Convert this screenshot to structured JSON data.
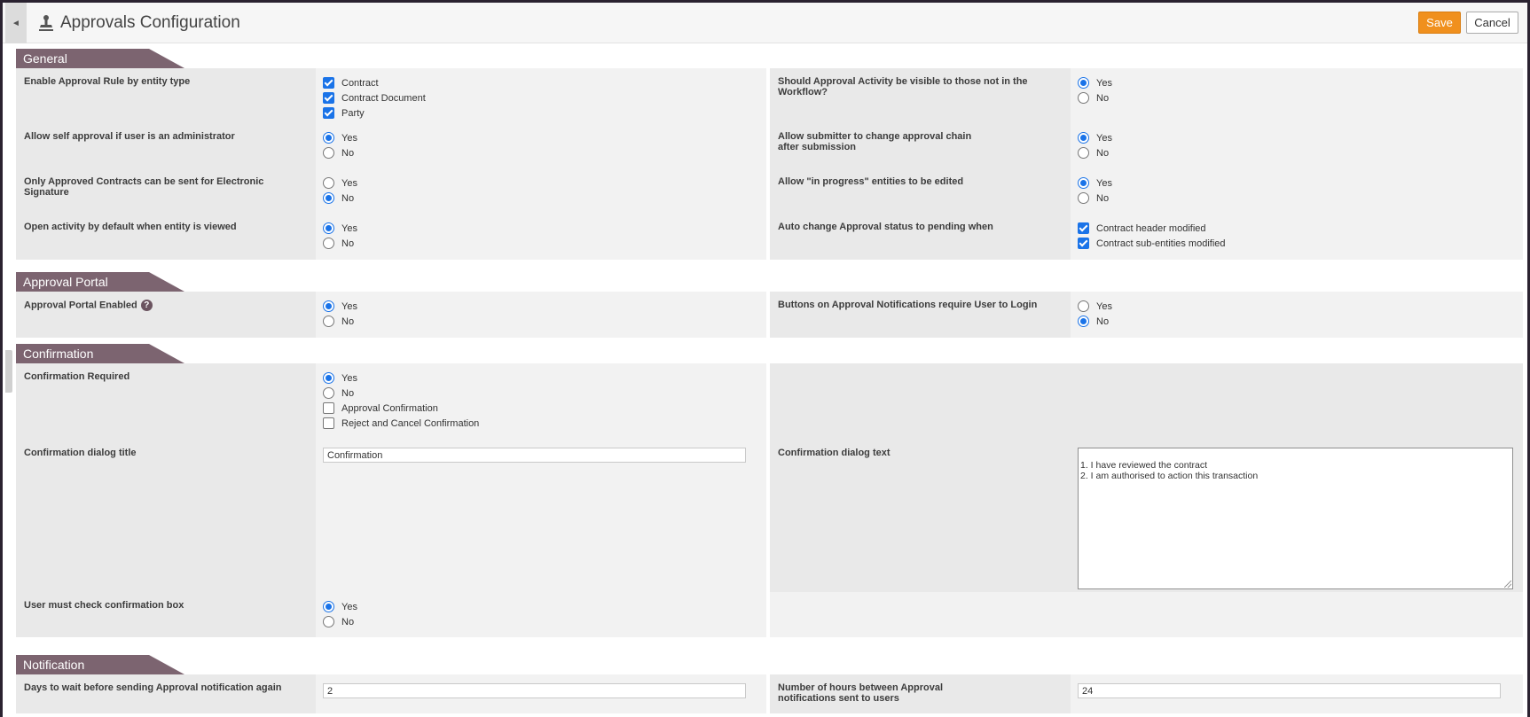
{
  "header": {
    "title": "Approvals Configuration",
    "save_label": "Save",
    "cancel_label": "Cancel",
    "back_glyph": "◄"
  },
  "icons": {
    "back": "triangle-left-icon",
    "title": "stamp-icon",
    "help": "question-circle-icon"
  },
  "colors": {
    "accent": "#f0901e",
    "section_header": "#7c6470",
    "control_blue": "#1a73e8"
  },
  "general": {
    "title": "General",
    "entity_type": {
      "label": "Enable Approval Rule by entity type",
      "options": [
        {
          "label": "Contract",
          "checked": true
        },
        {
          "label": "Contract Document",
          "checked": true
        },
        {
          "label": "Party",
          "checked": true
        }
      ]
    },
    "visible_activity": {
      "label": "Should Approval Activity be visible to those not in the Workflow?",
      "yes": "Yes",
      "no": "No",
      "selected": "Yes"
    },
    "self_approval": {
      "label": "Allow self approval if user is an administrator",
      "yes": "Yes",
      "no": "No",
      "selected": "Yes"
    },
    "change_chain": {
      "label": "Allow submitter to change approval chain after submission",
      "yes": "Yes",
      "no": "No",
      "selected": "Yes"
    },
    "esign": {
      "label": "Only Approved Contracts can be sent for Electronic Signature",
      "yes": "Yes",
      "no": "No",
      "selected": "No"
    },
    "in_progress": {
      "label": "Allow \"in progress\" entities to be edited",
      "yes": "Yes",
      "no": "No",
      "selected": "Yes"
    },
    "open_activity": {
      "label": "Open activity by default when entity is viewed",
      "yes": "Yes",
      "no": "No",
      "selected": "Yes"
    },
    "auto_pending": {
      "label": "Auto change Approval status to pending when",
      "options": [
        {
          "label": "Contract header modified",
          "checked": true
        },
        {
          "label": "Contract sub-entities modified",
          "checked": true
        }
      ]
    }
  },
  "portal": {
    "title": "Approval Portal",
    "enabled": {
      "label": "Approval Portal Enabled",
      "help": "?",
      "yes": "Yes",
      "no": "No",
      "selected": "Yes"
    },
    "login": {
      "label": "Buttons on Approval Notifications require User to Login",
      "yes": "Yes",
      "no": "No",
      "selected": "No"
    }
  },
  "confirmation": {
    "title": "Confirmation",
    "required": {
      "label": "Confirmation Required",
      "yes": "Yes",
      "no": "No",
      "selected": "Yes",
      "extra": [
        {
          "label": "Approval Confirmation",
          "checked": false
        },
        {
          "label": "Reject and Cancel Confirmation",
          "checked": false
        }
      ]
    },
    "dialog_title": {
      "label": "Confirmation dialog title",
      "value": "Confirmation"
    },
    "dialog_text": {
      "label": "Confirmation dialog text",
      "value": "1. I have reviewed the contract\n2. I am authorised to action this transaction"
    },
    "must_check": {
      "label": "User must check confirmation box",
      "yes": "Yes",
      "no": "No",
      "selected": "Yes"
    }
  },
  "notification": {
    "title": "Notification",
    "days_wait": {
      "label": "Days to wait before sending Approval notification again",
      "value": "2"
    },
    "hours_between": {
      "label": "Number of hours between Approval notifications sent to users",
      "value": "24"
    }
  }
}
